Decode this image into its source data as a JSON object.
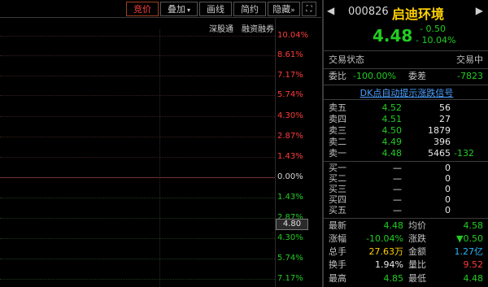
{
  "toolbar": {
    "price": "竞价",
    "overlay": "叠加",
    "draw": "画线",
    "simple": "简约",
    "hide": "隐藏",
    "expand": "expand-icon"
  },
  "sub_header": {
    "index": "深股通",
    "margin": "融资融券"
  },
  "axis": {
    "labels": [
      "10.04%",
      "8.61%",
      "7.17%",
      "5.74%",
      "4.30%",
      "2.87%",
      "1.43%",
      "0.00%",
      "1.43%",
      "2.87%",
      "4.30%",
      "5.74%",
      "7.17%"
    ],
    "current_price": "4.80"
  },
  "quote": {
    "nav_left": "◀",
    "nav_right": "▶",
    "code": "000826",
    "name": "启迪环境",
    "last": "4.48",
    "change": "- 0.50",
    "change_pct": "- 10.04%",
    "status_label": "交易状态",
    "status_value": "交易中",
    "ratio_label": "委比",
    "ratio_value": "-100.00%",
    "diff_label": "委差",
    "diff_value": "-7823",
    "dk_link": "DK点自动提示涨跌信号"
  },
  "order_book": {
    "asks": [
      {
        "label": "卖五",
        "price": "4.52",
        "vol": "56",
        "extra": ""
      },
      {
        "label": "卖四",
        "price": "4.51",
        "vol": "27",
        "extra": ""
      },
      {
        "label": "卖三",
        "price": "4.50",
        "vol": "1879",
        "extra": ""
      },
      {
        "label": "卖二",
        "price": "4.49",
        "vol": "396",
        "extra": ""
      },
      {
        "label": "卖一",
        "price": "4.48",
        "vol": "5465",
        "extra": "-132"
      }
    ],
    "bids": [
      {
        "label": "买一",
        "price": "—",
        "vol": "0"
      },
      {
        "label": "买二",
        "price": "—",
        "vol": "0"
      },
      {
        "label": "买三",
        "price": "—",
        "vol": "0"
      },
      {
        "label": "买四",
        "price": "—",
        "vol": "0"
      },
      {
        "label": "买五",
        "price": "—",
        "vol": "0"
      }
    ]
  },
  "stats": {
    "latest_label": "最新",
    "latest": "4.48",
    "avg_label": "均价",
    "avg": "4.58",
    "chgpct_label": "涨幅",
    "chgpct": "-10.04%",
    "chg_label": "涨跌",
    "chg": "▼0.50",
    "vol_label": "总手",
    "vol": "27.63万",
    "amt_label": "金额",
    "amt": "1.27亿",
    "turnover_label": "换手",
    "turnover": "1.94%",
    "volratio_label": "量比",
    "volratio": "9.52",
    "high_label": "最高",
    "high": "4.85",
    "low_label": "最低",
    "low": "4.48"
  },
  "colors": {
    "up": "#ff3b3b",
    "down": "#22cc22",
    "name": "#ffd200",
    "link": "#4aa0ff"
  }
}
